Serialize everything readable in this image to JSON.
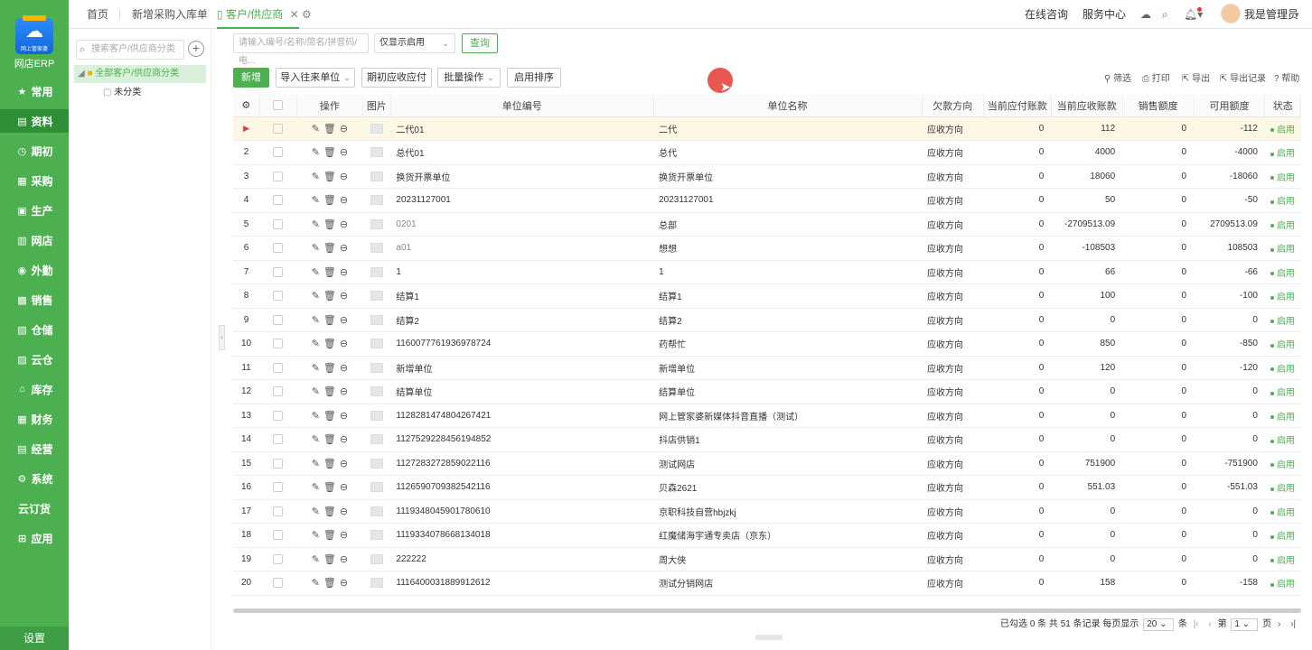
{
  "app": {
    "logo_text": "网店ERP",
    "logo_caption": "网上管家婆"
  },
  "sidebar": {
    "items": [
      {
        "label": "常用",
        "icon": "star-icon"
      },
      {
        "label": "资料",
        "icon": "folder-icon",
        "active": true
      },
      {
        "label": "期初",
        "icon": "clock-icon"
      },
      {
        "label": "采购",
        "icon": "cart-icon"
      },
      {
        "label": "生产",
        "icon": "factory-icon"
      },
      {
        "label": "网店",
        "icon": "store-icon"
      },
      {
        "label": "外勤",
        "icon": "location-icon"
      },
      {
        "label": "销售",
        "icon": "sales-icon"
      },
      {
        "label": "仓储",
        "icon": "warehouse-icon"
      },
      {
        "label": "云仓",
        "icon": "cloud-warehouse-icon"
      },
      {
        "label": "库存",
        "icon": "inventory-icon"
      },
      {
        "label": "财务",
        "icon": "finance-icon"
      },
      {
        "label": "经营",
        "icon": "business-icon"
      },
      {
        "label": "系统",
        "icon": "system-icon"
      },
      {
        "label": "云订货",
        "icon": ""
      },
      {
        "label": "应用",
        "icon": "app-icon"
      }
    ],
    "settings_label": "设置"
  },
  "tabs": [
    {
      "label": "首页"
    },
    {
      "label": "新增采购入库单"
    },
    {
      "label": "客户/供应商",
      "active": true
    }
  ],
  "topbar": {
    "online_consult": "在线咨询",
    "service_center": "服务中心",
    "user_name": "我是管理员"
  },
  "tree": {
    "search_placeholder": "搜索客户/供应商分类",
    "root_label": "全部客户/供应商分类",
    "child_label": "未分类"
  },
  "filters": {
    "keyword_placeholder": "请输入编号/名称/简名/拼音码/电...",
    "status_select": "仅显示启用",
    "query_button": "查询"
  },
  "toolbar": {
    "new_button": "新增",
    "import_button": "导入往来单位",
    "initial_button": "期初应收应付",
    "batch_button": "批量操作",
    "sort_button": "启用排序",
    "filter_tool": "筛选",
    "print_tool": "打印",
    "export_tool": "导出",
    "export_log_tool": "导出记录",
    "help_tool": "帮助"
  },
  "table": {
    "headers": {
      "op": "操作",
      "image": "图片",
      "code": "单位编号",
      "name": "单位名称",
      "direction": "欠款方向",
      "payable": "当前应付账款",
      "receivable": "当前应收账款",
      "sales_limit": "销售额度",
      "available_limit": "可用额度",
      "status": "状态"
    },
    "rows": [
      {
        "no": "",
        "code": "二代01",
        "name": "二代",
        "dir": "应收方向",
        "pay": "0",
        "recv": "112",
        "limit": "0",
        "avail": "-112",
        "status": "启用"
      },
      {
        "no": "2",
        "code": "总代01",
        "name": "总代",
        "dir": "应收方向",
        "pay": "0",
        "recv": "4000",
        "limit": "0",
        "avail": "-4000",
        "status": "启用"
      },
      {
        "no": "3",
        "code": "换货开票单位",
        "name": "换货开票单位",
        "dir": "应收方向",
        "pay": "0",
        "recv": "18060",
        "limit": "0",
        "avail": "-18060",
        "status": "启用"
      },
      {
        "no": "4",
        "code": "20231127001",
        "name": "20231127001",
        "dir": "应收方向",
        "pay": "0",
        "recv": "50",
        "limit": "0",
        "avail": "-50",
        "status": "启用"
      },
      {
        "no": "5",
        "code": "0201",
        "name": "总部",
        "dir": "应收方向",
        "pay": "0",
        "recv": "-2709513.09",
        "limit": "0",
        "avail": "2709513.09",
        "status": "启用"
      },
      {
        "no": "6",
        "code": "a01",
        "name": "想想",
        "dir": "应收方向",
        "pay": "0",
        "recv": "-108503",
        "limit": "0",
        "avail": "108503",
        "status": "启用"
      },
      {
        "no": "7",
        "code": "1",
        "name": "1",
        "dir": "应收方向",
        "pay": "0",
        "recv": "66",
        "limit": "0",
        "avail": "-66",
        "status": "启用"
      },
      {
        "no": "8",
        "code": "结算1",
        "name": "结算1",
        "dir": "应收方向",
        "pay": "0",
        "recv": "100",
        "limit": "0",
        "avail": "-100",
        "status": "启用"
      },
      {
        "no": "9",
        "code": "结算2",
        "name": "结算2",
        "dir": "应收方向",
        "pay": "0",
        "recv": "0",
        "limit": "0",
        "avail": "0",
        "status": "启用"
      },
      {
        "no": "10",
        "code": "1160077761936978724",
        "name": "药帮忙",
        "dir": "应收方向",
        "pay": "0",
        "recv": "850",
        "limit": "0",
        "avail": "-850",
        "status": "启用"
      },
      {
        "no": "11",
        "code": "新增单位",
        "name": "新增单位",
        "dir": "应收方向",
        "pay": "0",
        "recv": "120",
        "limit": "0",
        "avail": "-120",
        "status": "启用"
      },
      {
        "no": "12",
        "code": "结算单位",
        "name": "结算单位",
        "dir": "应收方向",
        "pay": "0",
        "recv": "0",
        "limit": "0",
        "avail": "0",
        "status": "启用"
      },
      {
        "no": "13",
        "code": "1128281474804267421",
        "name": "网上管家婆新媒体抖音直播（测试）",
        "dir": "应收方向",
        "pay": "0",
        "recv": "0",
        "limit": "0",
        "avail": "0",
        "status": "启用"
      },
      {
        "no": "14",
        "code": "1127529228456194852",
        "name": "抖店供销1",
        "dir": "应收方向",
        "pay": "0",
        "recv": "0",
        "limit": "0",
        "avail": "0",
        "status": "启用"
      },
      {
        "no": "15",
        "code": "1127283272859022116",
        "name": "测试网店",
        "dir": "应收方向",
        "pay": "0",
        "recv": "751900",
        "limit": "0",
        "avail": "-751900",
        "status": "启用"
      },
      {
        "no": "16",
        "code": "1126590709382542116",
        "name": "贝森2621",
        "dir": "应收方向",
        "pay": "0",
        "recv": "551.03",
        "limit": "0",
        "avail": "-551.03",
        "status": "启用"
      },
      {
        "no": "17",
        "code": "1119348045901780610",
        "name": "京职科技自营hbjzkj",
        "dir": "应收方向",
        "pay": "0",
        "recv": "0",
        "limit": "0",
        "avail": "0",
        "status": "启用"
      },
      {
        "no": "18",
        "code": "1119334078668134018",
        "name": "红魔储海宇通专卖店（京东）",
        "dir": "应收方向",
        "pay": "0",
        "recv": "0",
        "limit": "0",
        "avail": "0",
        "status": "启用"
      },
      {
        "no": "19",
        "code": "222222",
        "name": "周大侠",
        "dir": "应收方向",
        "pay": "0",
        "recv": "0",
        "limit": "0",
        "avail": "0",
        "status": "启用"
      },
      {
        "no": "20",
        "code": "1116400031889912612",
        "name": "测试分销网店",
        "dir": "应收方向",
        "pay": "0",
        "recv": "158",
        "limit": "0",
        "avail": "-158",
        "status": "启用"
      }
    ]
  },
  "pager": {
    "selected_prefix": "已勾选",
    "selected_count": "0",
    "selected_unit": "条 共",
    "total_count": "51",
    "total_unit": "条记录 每页显示",
    "page_size": "20",
    "page_size_unit": "条",
    "page_label": "第",
    "current_page": "1",
    "page_unit": "页"
  },
  "colors": {
    "brand_green": "#4caf50",
    "sidebar_active": "#2f8f37",
    "row_highlight": "#fdf8e6"
  }
}
